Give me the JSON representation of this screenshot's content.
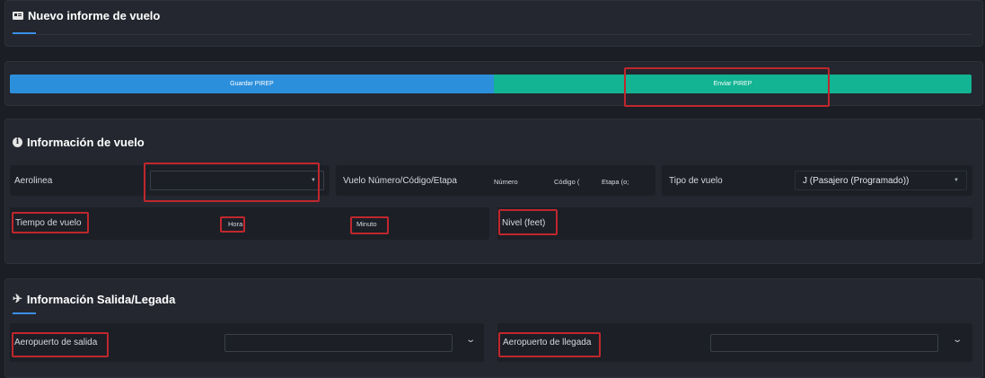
{
  "header": {
    "title": "Nuevo informe de vuelo",
    "icon": "plane-card-icon"
  },
  "actions": {
    "save_label": "Guardar PIREP",
    "send_label": "Enviar PIREP",
    "save_color": "#2c8fdc",
    "send_color": "#12b493"
  },
  "flight_info": {
    "title": "Información de vuelo",
    "icon": "info-icon",
    "airline_label": "Aerolinea",
    "airline_value": "",
    "flight_number_label": "Vuelo Número/Código/Etapa",
    "number_placeholder": "Número",
    "code_placeholder": "Código (",
    "leg_placeholder": "Etapa (o;",
    "flight_type_label": "Tipo de vuelo",
    "flight_type_value": "J (Pasajero (Programado))",
    "flight_time_label": "Tiempo de vuelo",
    "hour_label": "Hora",
    "minute_label": "Minuto",
    "level_label": "Nivel (feet)"
  },
  "route_info": {
    "title": "Información Salida/Legada",
    "icon": "departure-plane-icon",
    "departure_label": "Aeropuerto de salida",
    "departure_value": "",
    "arrival_label": "Aeropuerto de llegada",
    "arrival_value": ""
  },
  "highlight_color": "#c0272d"
}
